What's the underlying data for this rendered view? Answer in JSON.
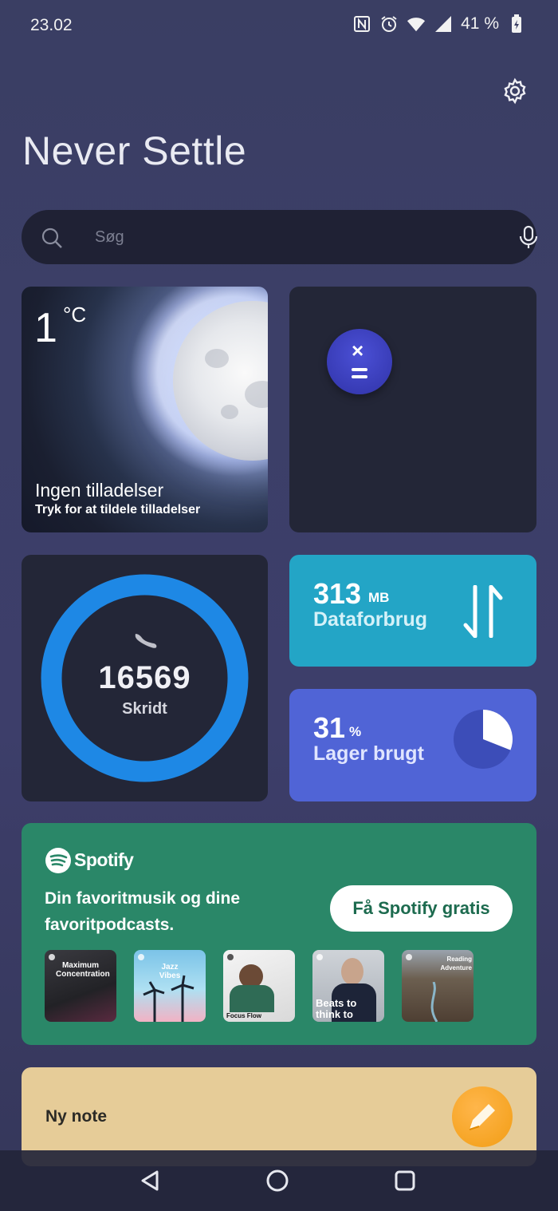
{
  "status_bar": {
    "time": "23.02",
    "battery_percent": "41 %",
    "icons": [
      "nfc-icon",
      "alarm-icon",
      "wifi-icon",
      "signal-icon",
      "battery-charging-icon"
    ]
  },
  "header": {
    "title": "Never Settle",
    "settings_icon": "gear-icon"
  },
  "search": {
    "placeholder": "Søg",
    "left_icon": "search-icon",
    "right_icon": "microphone-icon"
  },
  "weather": {
    "temperature": "1",
    "unit": "°C",
    "title": "Ingen tilladelser",
    "subtitle": "Tryk for at tildele tilladelser"
  },
  "calculator": {
    "icon": "calculator-icon"
  },
  "steps": {
    "count": "16569",
    "label": "Skridt",
    "ring_color": "#1e88e5"
  },
  "data_usage": {
    "value": "313",
    "unit": "MB",
    "label": "Dataforbrug",
    "color": "#23a5c6"
  },
  "storage": {
    "value": "31",
    "unit": "%",
    "label": "Lager brugt",
    "fraction_used": 0.31,
    "color": "#5064d6"
  },
  "spotify": {
    "brand": "Spotify",
    "tagline": "Din favoritmusik og dine favoritpodcasts.",
    "cta": "Få Spotify gratis",
    "playlists": [
      {
        "title": "Maximum Concentration"
      },
      {
        "title": "Jazz Vibes"
      },
      {
        "title": "Focus Flow"
      },
      {
        "title": "Beats to think to"
      },
      {
        "title": "Reading Adventure"
      }
    ]
  },
  "note": {
    "label": "Ny note",
    "icon": "pencil-icon"
  },
  "nav": {
    "back": "back-icon",
    "home": "home-icon",
    "recents": "recents-icon"
  }
}
